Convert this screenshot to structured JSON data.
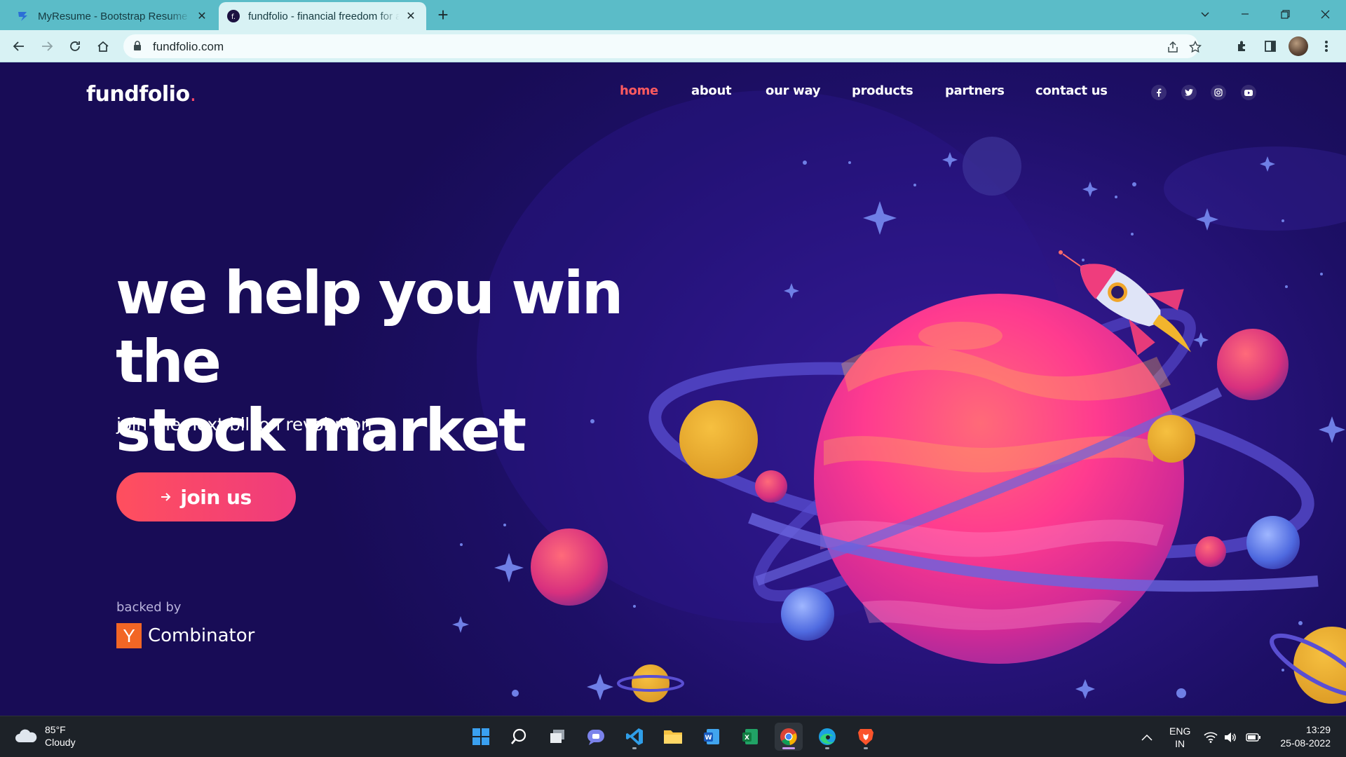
{
  "browser": {
    "tabs": [
      {
        "title": "MyResume - Bootstrap Resume and CV Template",
        "active": false
      },
      {
        "title": "fundfolio - financial freedom for all",
        "active": true
      }
    ],
    "url": "fundfolio.com"
  },
  "site": {
    "logo_text": "fundfolio",
    "logo_dot": ".",
    "nav": [
      "home",
      "about",
      "our way",
      "products",
      "partners",
      "contact us"
    ],
    "nav_active": "home",
    "social": [
      "facebook-icon",
      "twitter-icon",
      "instagram-icon",
      "youtube-icon"
    ],
    "headline_line1": "we help you win the",
    "headline_line2": "stock market",
    "subheadline": "join the next billion revolution",
    "cta_label": "join us",
    "backed_by_label": "backed by",
    "backer_letter": "Y",
    "backer_name": "Combinator",
    "colors": {
      "accent": "#ff5a5f",
      "background": "#1d0f66",
      "planet": "#ff3f8e",
      "gold": "#e8a92c"
    }
  },
  "taskbar": {
    "weather_temp": "85°F",
    "weather_desc": "Cloudy",
    "apps": [
      "start-icon",
      "search-icon",
      "task-view-icon",
      "teams-chat-icon",
      "vscode-icon",
      "file-explorer-icon",
      "word-icon",
      "excel-icon",
      "chrome-icon",
      "edge-icon",
      "brave-icon"
    ],
    "lang_line1": "ENG",
    "lang_line2": "IN",
    "time": "13:29",
    "date": "25-08-2022"
  }
}
